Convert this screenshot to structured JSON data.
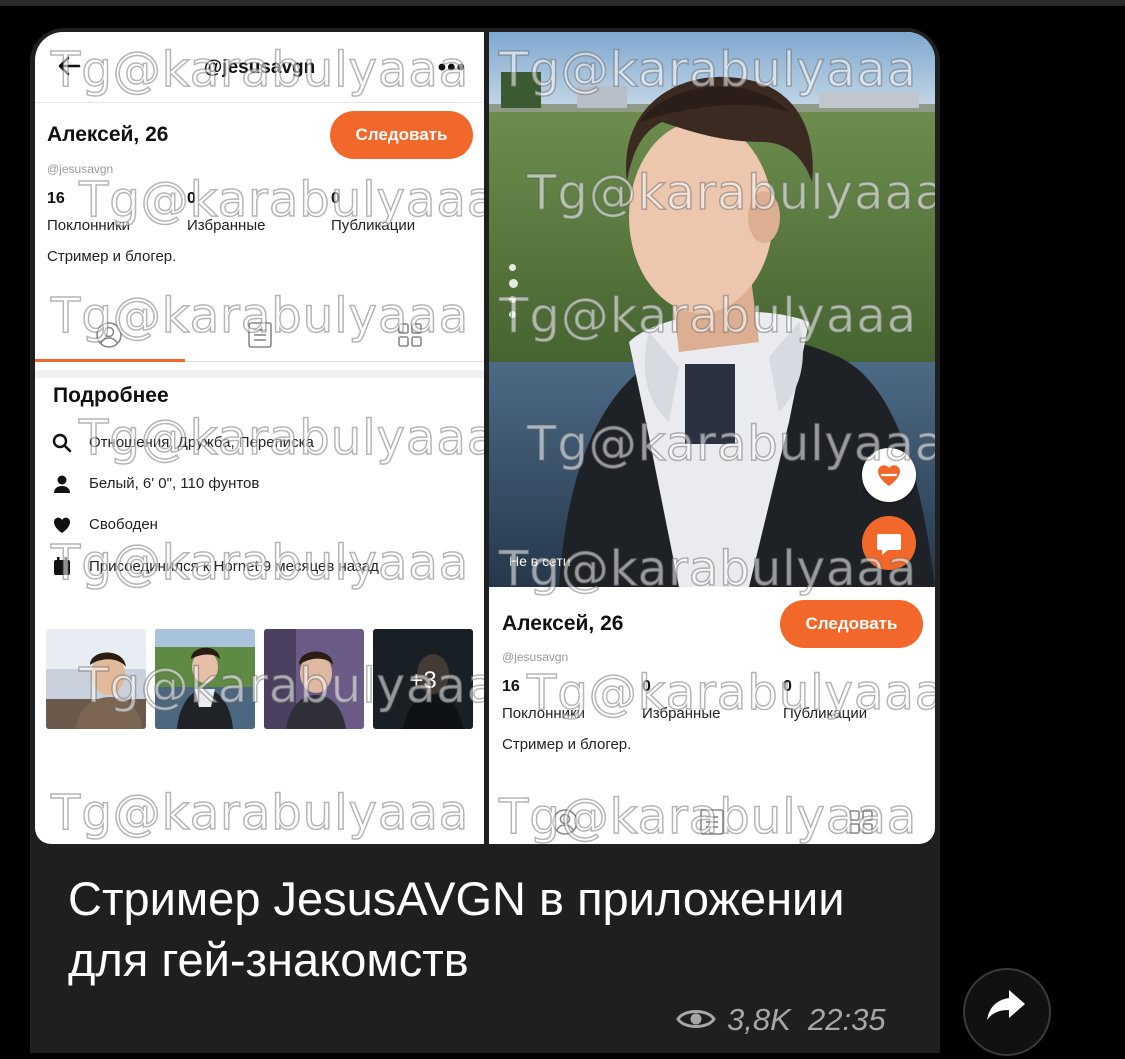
{
  "watermark": "Tg@karabulyaaa",
  "left_screen": {
    "header_title": "@jesusavgn",
    "name_age": "Алексей, 26",
    "follow_label": "Следовать",
    "handle": "@jesusavgn",
    "stats": [
      {
        "value": "16",
        "label": "Поклонники"
      },
      {
        "value": "0",
        "label": "Избранные"
      },
      {
        "value": "0",
        "label": "Публикации"
      }
    ],
    "bio": "Стример и блогер.",
    "details_title": "Подробнее",
    "details": [
      {
        "icon": "search-icon",
        "text": "Отношения, Дружба, Переписка"
      },
      {
        "icon": "person-icon",
        "text": "Белый, 6' 0\", 110 фунтов"
      },
      {
        "icon": "heart-icon",
        "text": "Свободен"
      },
      {
        "icon": "calendar-icon",
        "text": "Присоединился к Hornet 9 месяцев назад"
      }
    ],
    "more_photos": "+3"
  },
  "right_screen": {
    "status": "Не в сети",
    "name_age": "Алексей, 26",
    "follow_label": "Следовать",
    "handle": "@jesusavgn",
    "stats": [
      {
        "value": "16",
        "label": "Поклонники"
      },
      {
        "value": "0",
        "label": "Избранные"
      },
      {
        "value": "0",
        "label": "Публикации"
      }
    ],
    "bio": "Стример и блогер."
  },
  "message": {
    "caption": "Стример JesusAVGN в приложении для гей-знакомств",
    "views": "3,8K",
    "time": "22:35"
  },
  "colors": {
    "accent": "#f2672a",
    "bubble": "#1f1f1f"
  }
}
